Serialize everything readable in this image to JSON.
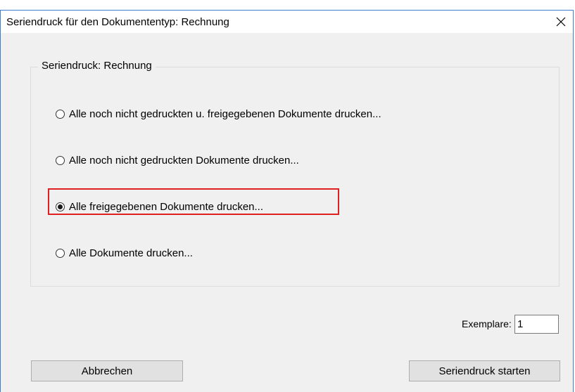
{
  "window": {
    "title": "Seriendruck für den Dokumententyp: Rechnung"
  },
  "group": {
    "legend": "Seriendruck: Rechnung",
    "options": [
      {
        "label": "Alle noch nicht gedruckten u. freigegebenen Dokumente drucken...",
        "checked": false
      },
      {
        "label": "Alle noch nicht gedruckten Dokumente drucken...",
        "checked": false
      },
      {
        "label": "Alle freigegebenen Dokumente drucken...",
        "checked": true,
        "highlighted": true
      },
      {
        "label": "Alle Dokumente drucken...",
        "checked": false
      }
    ]
  },
  "copies": {
    "label": "Exemplare:",
    "value": "1"
  },
  "buttons": {
    "cancel": "Abbrechen",
    "start": "Seriendruck starten"
  },
  "colors": {
    "highlight": "#e02020",
    "window_border": "#3c7fd0",
    "dialog_background": "#f0f0f0"
  }
}
